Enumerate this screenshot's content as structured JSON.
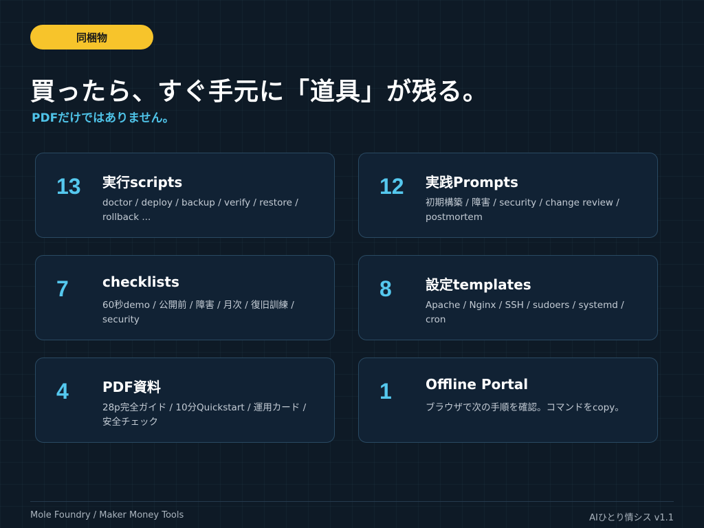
{
  "badge": "同梱物",
  "title": "買ったら、すぐ手元に「道具」が残る。",
  "subtitle": "PDFだけではありません。",
  "cards": [
    {
      "num": "13",
      "title": "実行scripts",
      "desc": "doctor / deploy / backup / verify / restore / rollback ..."
    },
    {
      "num": "12",
      "title": "実践Prompts",
      "desc": "初期構築 / 障害 / security / change review / postmortem"
    },
    {
      "num": "7",
      "title": "checklists",
      "desc": "60秒demo / 公開前 / 障害 / 月次 / 復旧訓練 / security"
    },
    {
      "num": "8",
      "title": "設定templates",
      "desc": "Apache / Nginx / SSH / sudoers / systemd / cron"
    },
    {
      "num": "4",
      "title": "PDF資料",
      "desc": "28p完全ガイド / 10分Quickstart / 運用カード / 安全チェック"
    },
    {
      "num": "1",
      "title": "Offline Portal",
      "desc": "ブラウザで次の手順を確認。コマンドをcopy。"
    }
  ],
  "footer": {
    "left": "Mole Foundry / Maker Money Tools",
    "right": "AIひとり情シス v1.1"
  }
}
